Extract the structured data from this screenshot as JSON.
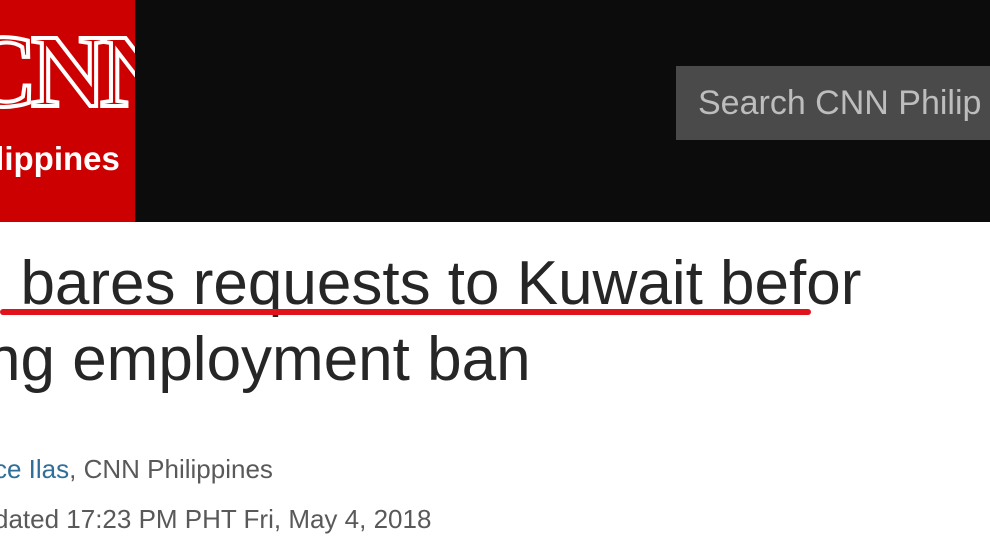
{
  "header": {
    "logo_main": "CNN",
    "logo_sub": "ilippines",
    "search_placeholder": "Search CNN Philip"
  },
  "article": {
    "headline_line1_prefix": "I bares requests to Kuwait",
    "headline_line1_suffix": " befor",
    "headline_line2": "ng employment ban",
    "byline_author": "ce Ilas",
    "byline_sep": ", ",
    "byline_outlet": "CNN Philippines",
    "timestamp": "dated 17:23 PM PHT Fri, May 4, 2018"
  },
  "colors": {
    "logo_red": "#cc0000",
    "topbar": "#0c0c0c",
    "search_bg": "#4a4a4a",
    "underline_red": "#e0121c",
    "link_blue": "#2f6f9a"
  }
}
